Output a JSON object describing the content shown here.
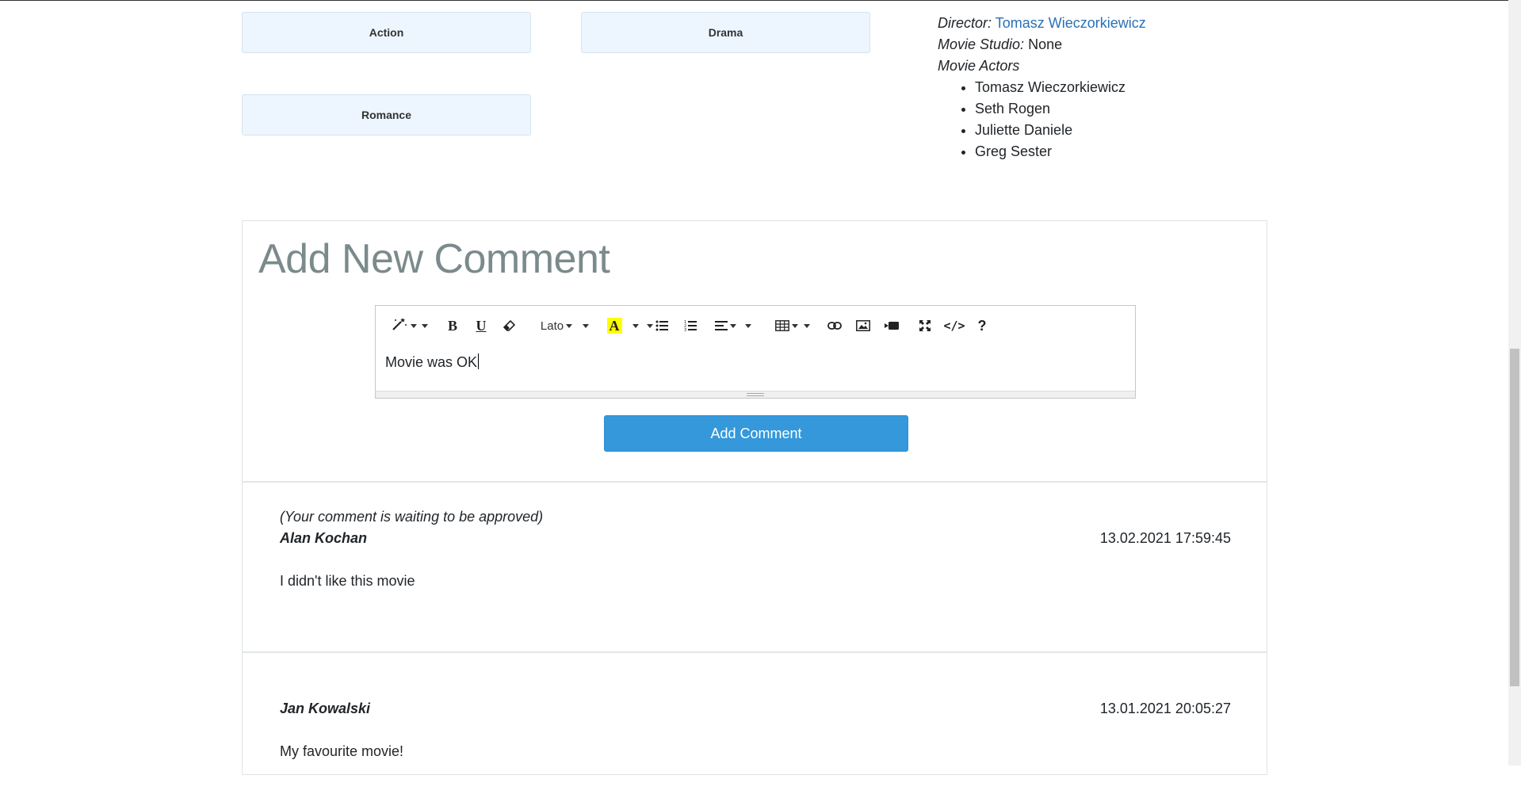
{
  "genres": [
    "Action",
    "Drama",
    "Romance"
  ],
  "details": {
    "director_label": "Director:",
    "director_name": "Tomasz Wieczorkiewicz",
    "studio_label": "Movie Studio:",
    "studio_value": "None",
    "actors_label": "Movie Actors",
    "actors": [
      "Tomasz Wieczorkiewicz",
      "Seth Rogen",
      "Juliette Daniele",
      "Greg Sester"
    ]
  },
  "comment_form": {
    "title": "Add New Comment",
    "editor_value": "Movie was OK",
    "font_name": "Lato",
    "submit_label": "Add Comment"
  },
  "toolbar_icons": [
    "magic-wand-icon",
    "bold-icon",
    "underline-icon",
    "eraser-icon",
    "font-name-dropdown",
    "highlight-color-icon",
    "bullet-list-icon",
    "numbered-list-icon",
    "align-icon",
    "table-icon",
    "link-icon",
    "image-icon",
    "video-icon",
    "fullscreen-icon",
    "code-view-icon",
    "help-icon"
  ],
  "toolbar_glyphs": {
    "bold": "B",
    "underline": "U",
    "highlight": "A",
    "code": "</>",
    "help": "?"
  },
  "comments": [
    {
      "note": "(Your comment is waiting to be approved)",
      "author": "Alan Kochan",
      "date": "13.02.2021 17:59:45",
      "text": "I didn't like this movie"
    },
    {
      "note": "",
      "author": "Jan Kowalski",
      "date": "13.01.2021 20:05:27",
      "text": "My favourite movie!"
    }
  ],
  "colors": {
    "accent": "#3498db",
    "link": "#2a70b8",
    "genre_bg": "#edf6fe",
    "title": "#7b8a8b",
    "highlight": "#ffff00"
  }
}
